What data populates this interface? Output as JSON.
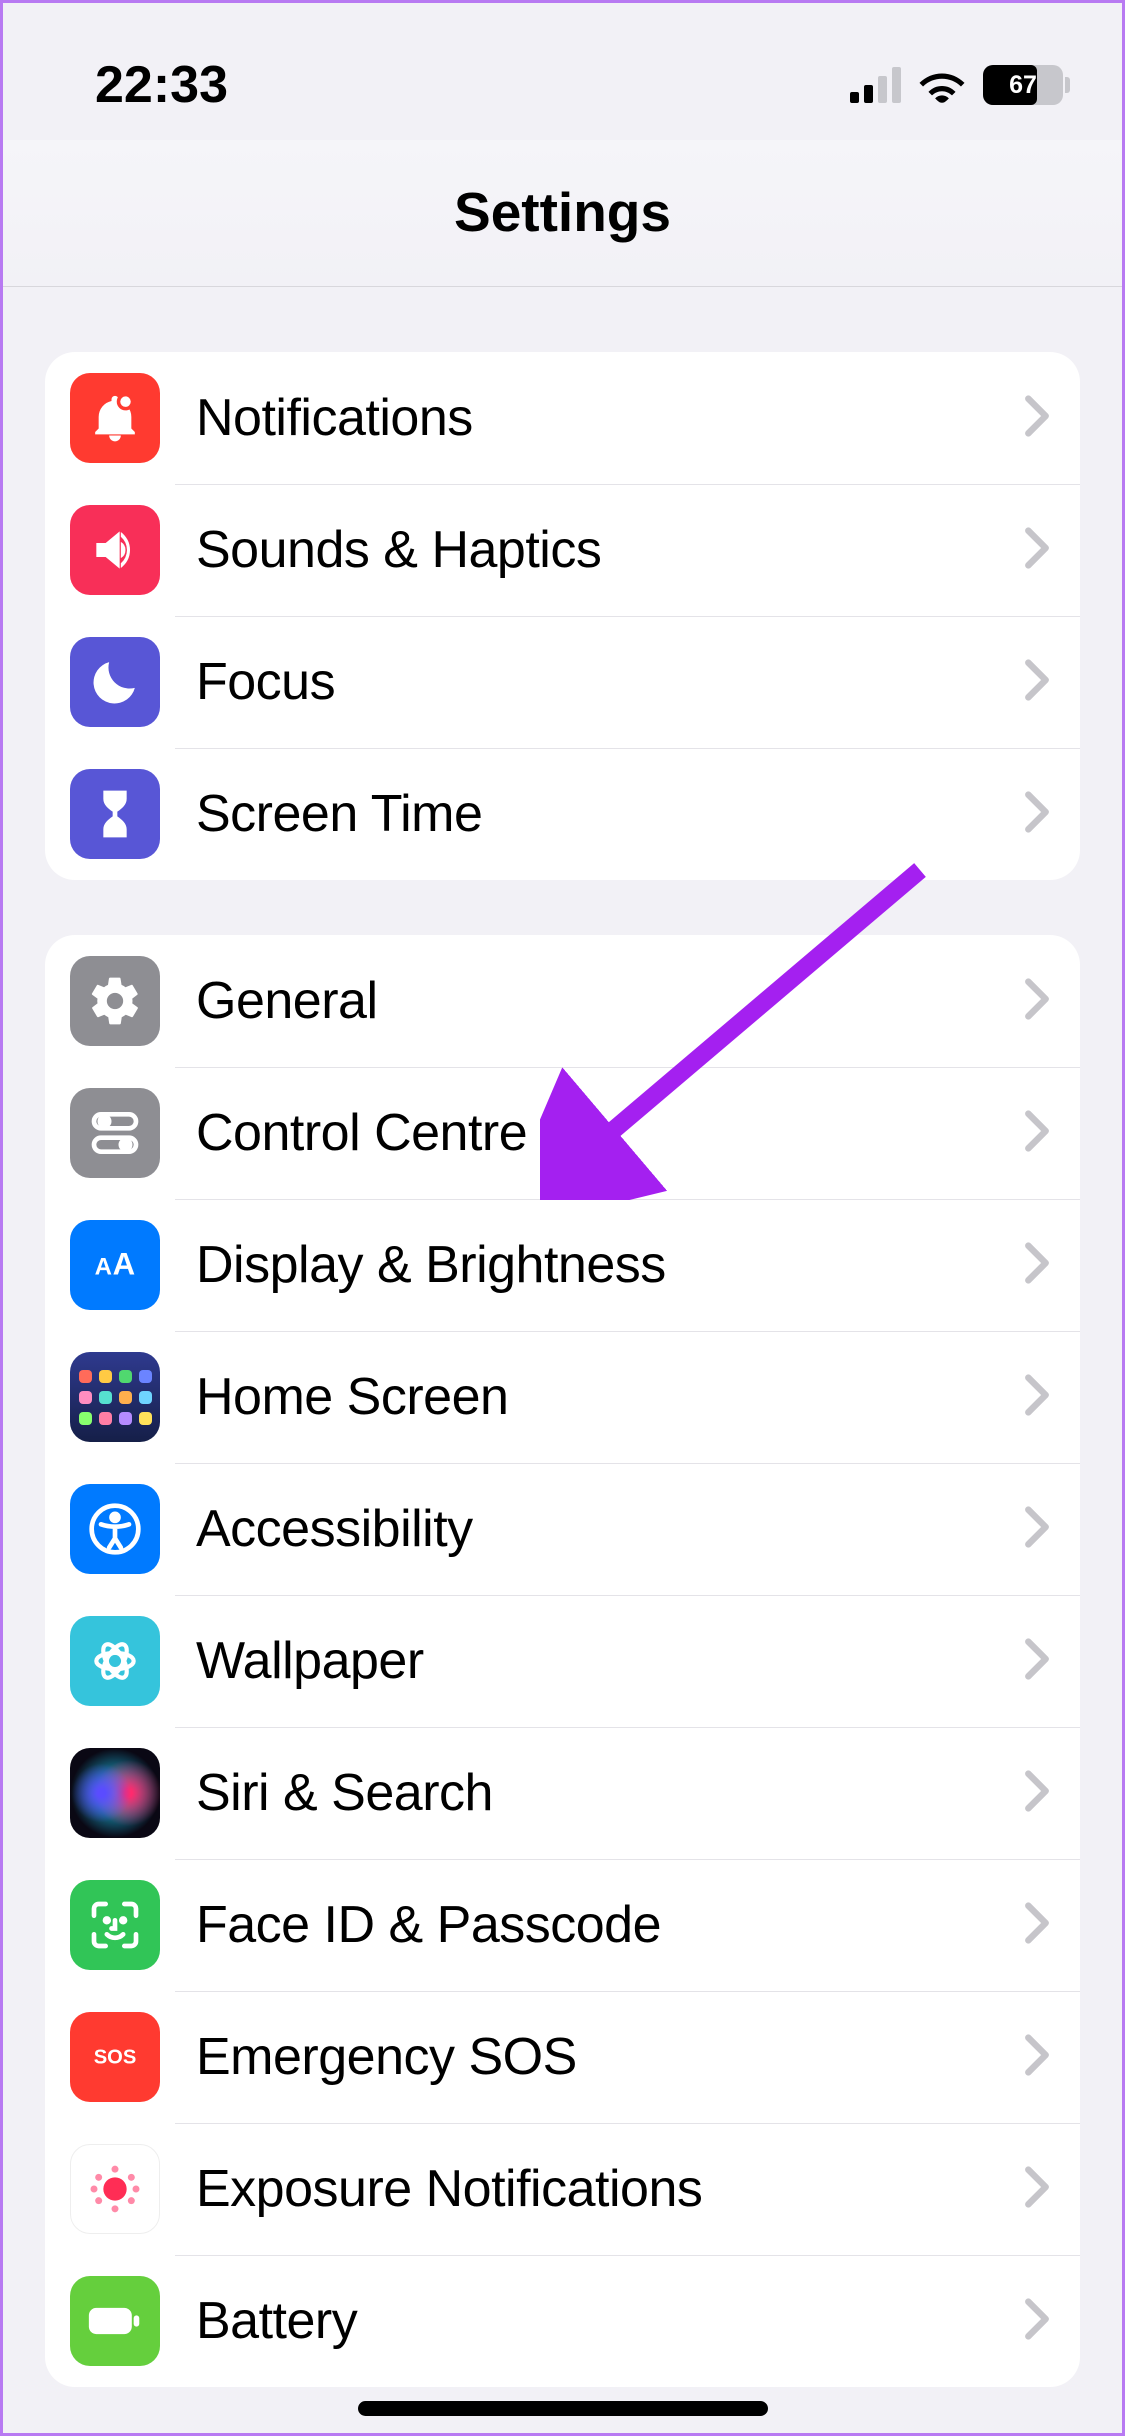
{
  "statusbar": {
    "time": "22:33",
    "battery": "67"
  },
  "header": {
    "title": "Settings"
  },
  "group1": {
    "0": {
      "label": "Notifications"
    },
    "1": {
      "label": "Sounds & Haptics"
    },
    "2": {
      "label": "Focus"
    },
    "3": {
      "label": "Screen Time"
    }
  },
  "group2": {
    "0": {
      "label": "General"
    },
    "1": {
      "label": "Control Centre"
    },
    "2": {
      "label": "Display & Brightness"
    },
    "3": {
      "label": "Home Screen"
    },
    "4": {
      "label": "Accessibility"
    },
    "5": {
      "label": "Wallpaper"
    },
    "6": {
      "label": "Siri & Search"
    },
    "7": {
      "label": "Face ID & Passcode"
    },
    "8": {
      "label": "Emergency SOS"
    },
    "9": {
      "label": "Exposure Notifications"
    },
    "10": {
      "label": "Battery"
    }
  }
}
